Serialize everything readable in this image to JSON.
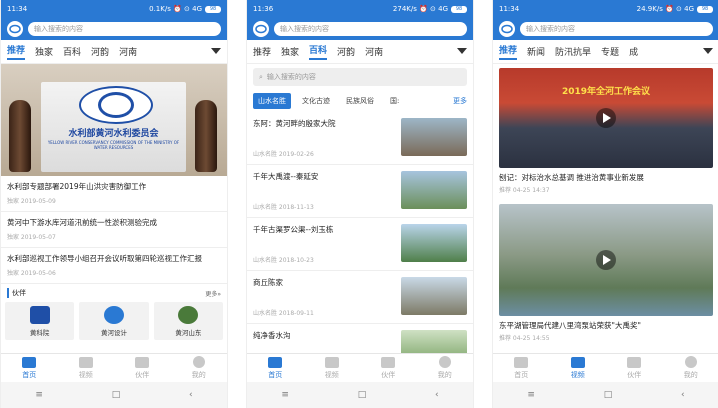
{
  "colors": {
    "accent": "#2a79d3"
  },
  "phones": [
    {
      "status": {
        "time": "11:34",
        "right": "0.1K/s ⏰ ⊙ 4G",
        "battery": "98"
      },
      "search_placeholder": "输入搜索的内容",
      "tabs": [
        "推荐",
        "独家",
        "百科",
        "河韵",
        "河南"
      ],
      "hero": {
        "title": "水利部黄河水利委员会",
        "subtitle": "YELLOW RIVER CONSERVANCY COMMISSION OF THE MINISTRY OF WATER RESOURCES"
      },
      "news": [
        {
          "title": "水利部专题部署2019年山洪灾害防御工作",
          "date": "独家 2019-05-09"
        },
        {
          "title": "黄河中下游水库河道汛前统一性淤积测验完成",
          "date": "独家 2019-05-07"
        },
        {
          "title": "水利部巡视工作领导小组召开会议听取第四轮巡视工作汇报",
          "date": "独家 2019-05-06"
        }
      ],
      "partners": {
        "label": "伙伴",
        "more": "更多»",
        "items": [
          "黄科院",
          "黄河设计",
          "黄河山东"
        ]
      },
      "nav": [
        "首页",
        "视频",
        "伙伴",
        "我的"
      ]
    },
    {
      "status": {
        "time": "11:36",
        "right": "274K/s ⏰ ⊙ 4G",
        "battery": "98"
      },
      "search_placeholder": "输入搜索的内容",
      "tabs": [
        "推荐",
        "独家",
        "百科",
        "河韵",
        "河南"
      ],
      "search2_placeholder": "输入搜索的内容",
      "chips": [
        "山水名胜",
        "文化古迹",
        "民族风俗",
        "国:"
      ],
      "chips_more": "更多",
      "list": [
        {
          "title": "东阿：黄河畔的殷家大院",
          "date": "山水名胜 2019-02-26"
        },
        {
          "title": "千年大禹渡--秦延安",
          "date": "山水名胜 2018-11-13"
        },
        {
          "title": "千年古渠罗公渠--刘玉栋",
          "date": "山水名胜 2018-10-23"
        },
        {
          "title": "商丘陈家",
          "date": "山水名胜 2018-09-11"
        },
        {
          "title": "纯净香水沟",
          "date": ""
        }
      ],
      "nav": [
        "首页",
        "视频",
        "伙伴",
        "我的"
      ]
    },
    {
      "status": {
        "time": "11:34",
        "right": "24.9K/s ⏰ ⊙ 4G",
        "battery": "98"
      },
      "search_placeholder": "输入搜索的内容",
      "tabs": [
        "推荐",
        "新闻",
        "防汛抗旱",
        "专题",
        "成"
      ],
      "videos": [
        {
          "title": "刨记：对标治水总基调 推进治黄事业新发展",
          "date": "推荐  04-25 14:37",
          "banner": "2019年全河工作会议"
        },
        {
          "title": "东平湖管理局代建八里湾泵站荣获\"大禹奖\"",
          "date": "推荐  04-25 14:55",
          "banner": ""
        }
      ],
      "nav": [
        "首页",
        "视频",
        "伙伴",
        "我的"
      ]
    }
  ],
  "sysnav": [
    "≡",
    "□",
    "‹"
  ]
}
